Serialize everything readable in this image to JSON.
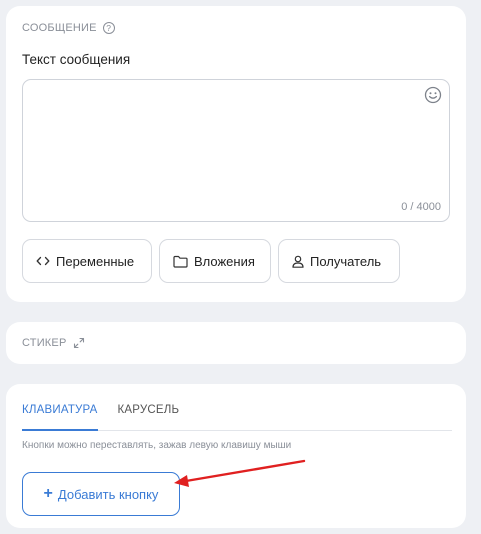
{
  "message_section": {
    "title": "СООБЩЕНИЕ",
    "help_glyph": "?",
    "field_label": "Текст сообщения",
    "text_value": "",
    "counter": "0 / 4000",
    "buttons": {
      "variables": "Переменные",
      "attachments": "Вложения",
      "recipient": "Получатель"
    }
  },
  "sticker_section": {
    "title": "СТИКЕР"
  },
  "keyboard_section": {
    "tabs": [
      "КЛАВИАТУРА",
      "КАРУСЕЛЬ"
    ],
    "active_tab": 0,
    "hint": "Кнопки можно переставлять, зажав левую клавишу мыши",
    "add_button": "Добавить кнопку",
    "add_glyph": "+"
  },
  "colors": {
    "accent": "#3a7bd5",
    "annotation_arrow": "#e02020",
    "muted_text": "#8a8f98",
    "background": "#eef0f4"
  },
  "icons": [
    "help-icon",
    "smile-icon",
    "code-icon",
    "folder-icon",
    "user-icon",
    "expand-icon",
    "plus-icon"
  ]
}
